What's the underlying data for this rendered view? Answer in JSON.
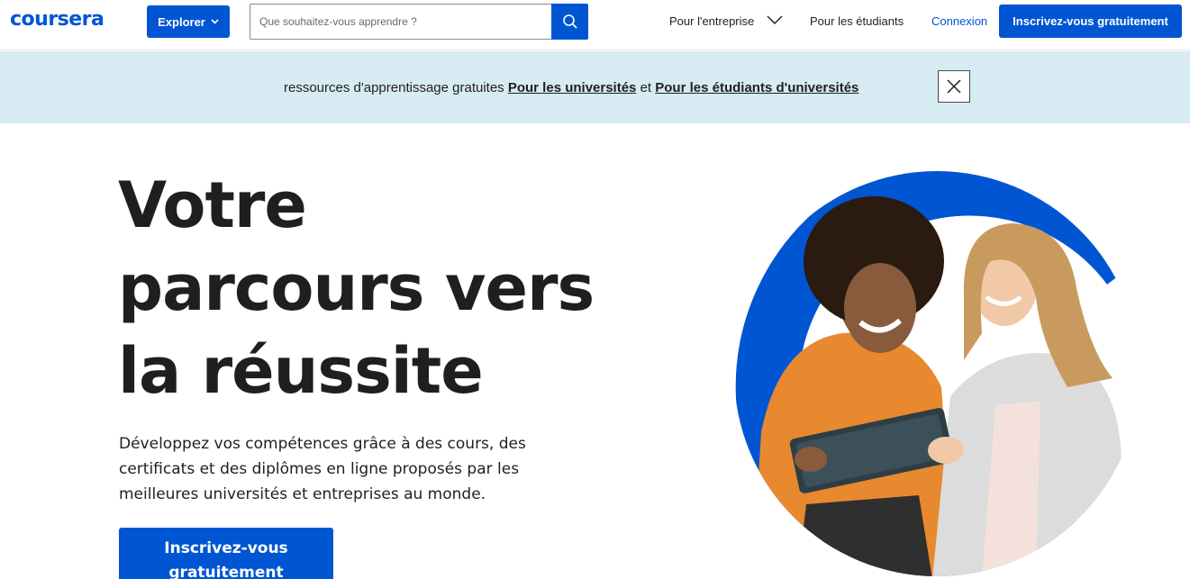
{
  "header": {
    "logo": "coursera",
    "explore_label": "Explorer",
    "search_placeholder": "Que souhaitez-vous apprendre ?",
    "nav_enterprise": "Pour l'entreprise",
    "nav_students": "Pour les étudiants",
    "login": "Connexion",
    "signup": "Inscrivez-vous gratuitement"
  },
  "banner": {
    "prefix": "ressources d'apprentissage gratuites ",
    "link_universities": "Pour les universités",
    "connector": " et ",
    "link_students": "Pour les étudiants d'universités"
  },
  "hero": {
    "title_line1": "Votre",
    "title_line2": "parcours vers",
    "title_line3": "la réussite",
    "description": "Développez vos compétences grâce à des cours, des certificats et des diplômes en ligne proposés par les meilleures universités et entreprises au monde.",
    "cta_line1": "Inscrivez-vous",
    "cta_line2": "gratuitement"
  },
  "colors": {
    "brand": "#0056d2",
    "banner_bg": "#d7ebf3",
    "text": "#1f1f1f"
  },
  "icons": {
    "search": "search-icon",
    "chevron": "chevron-down-icon",
    "close": "close-icon"
  }
}
